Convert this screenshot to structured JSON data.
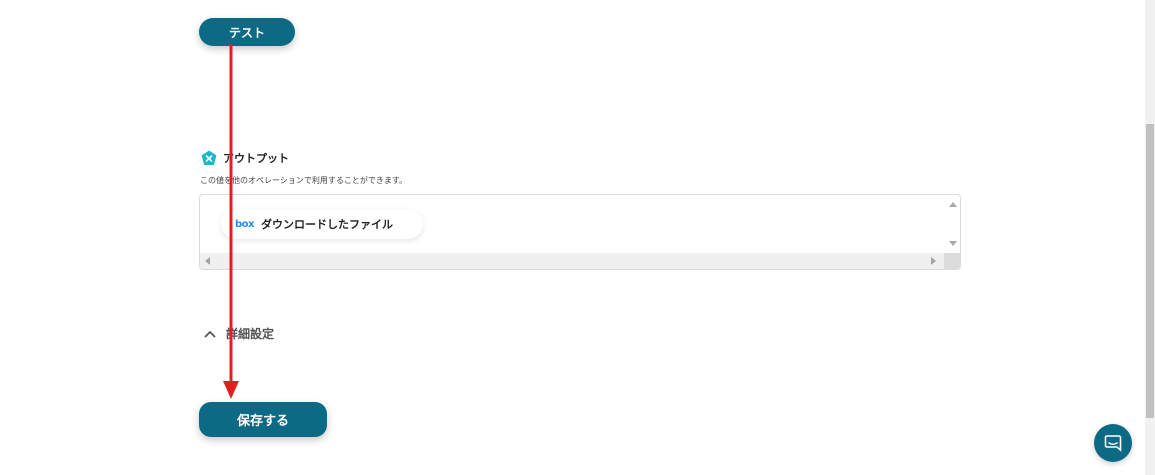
{
  "test_button": {
    "label": "テスト"
  },
  "output": {
    "title": "アウトプット",
    "description": "この値を他のオペレーションで利用することができます。",
    "items": [
      {
        "service_icon": "box",
        "label": "ダウンロードしたファイル"
      }
    ]
  },
  "advanced": {
    "label": "詳細設定",
    "state": "expanded",
    "chevron_icon": "chevron-up-icon"
  },
  "save_button": {
    "label": "保存する"
  },
  "chat_widget": {
    "icon": "chat-icon"
  },
  "annotation_arrow": {
    "color": "#e02020"
  },
  "colors": {
    "primary": "#0c6a84",
    "accent": "#1fb6c9",
    "box_brand": "#1f8ff0"
  }
}
